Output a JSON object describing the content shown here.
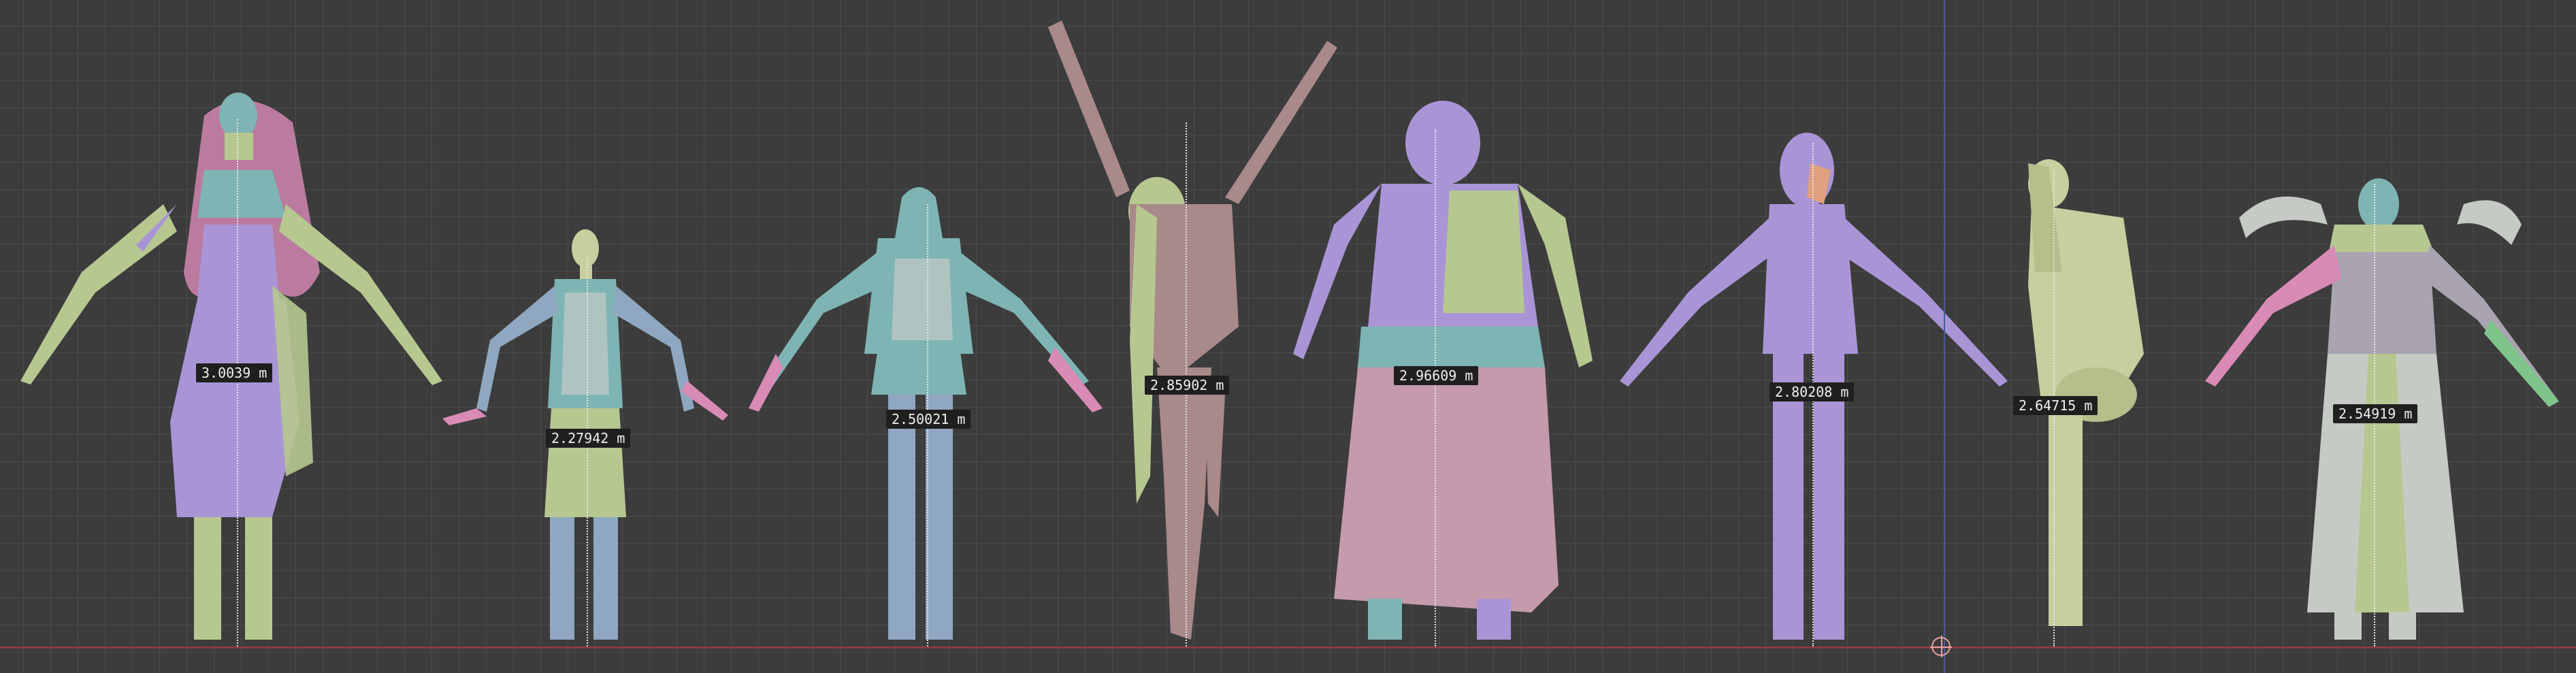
{
  "viewport": {
    "grid_color": "#5a5a5a",
    "background_color": "#3c3c3c",
    "ground_line_color": "#8c3b40",
    "y_axis_color": "#3f5e96"
  },
  "colors": {
    "lilac": "#a995d6",
    "sage": "#b6c890",
    "teal": "#7eb4b4",
    "steel_blue": "#8fa7c0",
    "pink": "#d98bb6",
    "mauve": "#a9898a",
    "pale_green": "#c8cf9e",
    "silver": "#c5cac4"
  },
  "measurements": [
    {
      "label": "3.0039 m"
    },
    {
      "label": "2.27942 m"
    },
    {
      "label": "2.50021 m"
    },
    {
      "label": "2.85902 m"
    },
    {
      "label": "2.96609 m"
    },
    {
      "label": "2.80208 m"
    },
    {
      "label": "2.64715 m"
    },
    {
      "label": "2.54919 m"
    }
  ]
}
